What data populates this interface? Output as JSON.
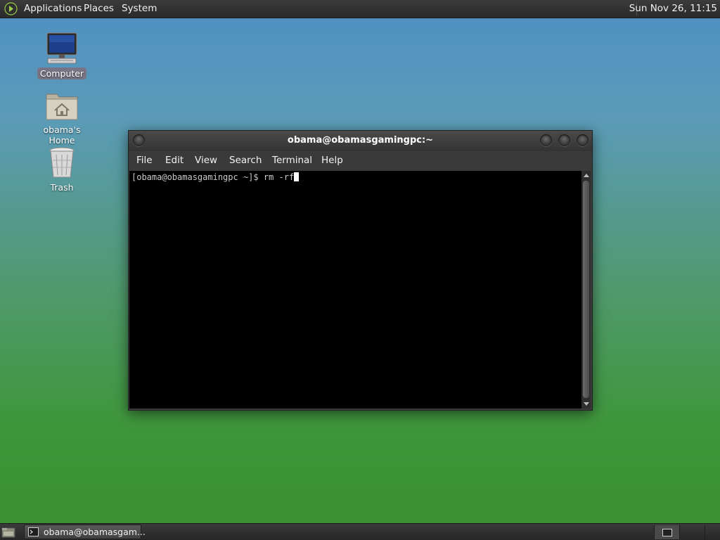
{
  "top_panel": {
    "menus": [
      "Applications",
      "Places",
      "System"
    ],
    "clock": "Sun Nov 26, 11:15"
  },
  "desktop": {
    "icons": [
      {
        "label": "Computer",
        "icon": "computer-icon",
        "selected": true
      },
      {
        "label": "obama's Home",
        "icon": "home-folder-icon",
        "selected": false
      },
      {
        "label": "Trash",
        "icon": "trash-icon",
        "selected": false
      }
    ]
  },
  "terminal_window": {
    "title": "obama@obamasgamingpc:~",
    "menu": [
      "File",
      "Edit",
      "View",
      "Search",
      "Terminal",
      "Help"
    ],
    "prompt": "[obama@obamasgamingpc ~]$ ",
    "command": "rm -rf"
  },
  "bottom_panel": {
    "taskbar_item": "obama@obamasgam..."
  }
}
